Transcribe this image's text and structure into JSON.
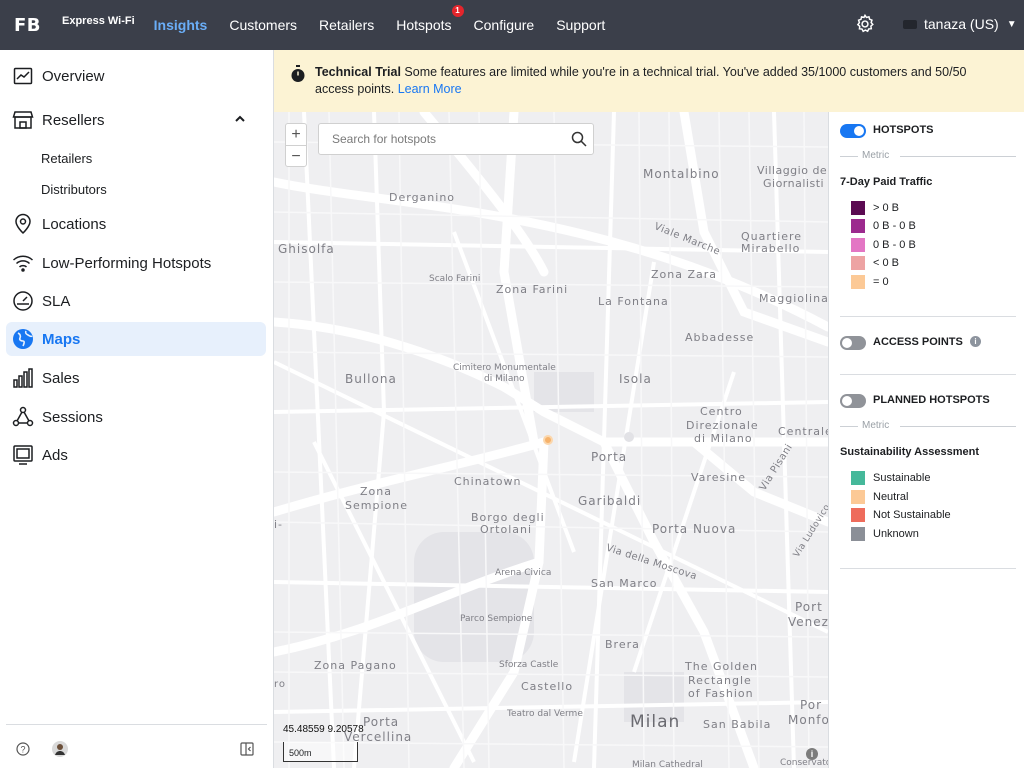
{
  "topbar": {
    "logo": "FB",
    "product": "Express Wi-Fi",
    "nav": [
      {
        "label": "Insights",
        "active": true
      },
      {
        "label": "Customers"
      },
      {
        "label": "Retailers"
      },
      {
        "label": "Hotspots",
        "badge": "1"
      },
      {
        "label": "Configure"
      },
      {
        "label": "Support"
      }
    ],
    "account": "tanaza (US)"
  },
  "sidebar": {
    "items": [
      {
        "label": "Overview",
        "icon": "line-chart-icon"
      },
      {
        "label": "Resellers",
        "icon": "store-icon",
        "expanded": true
      },
      {
        "label": "Locations",
        "icon": "location-pin-icon"
      },
      {
        "label": "Low-Performing Hotspots",
        "icon": "wifi-icon"
      },
      {
        "label": "SLA",
        "icon": "gauge-icon"
      },
      {
        "label": "Maps",
        "icon": "globe-icon",
        "active": true
      },
      {
        "label": "Sales",
        "icon": "bar-chart-icon"
      },
      {
        "label": "Sessions",
        "icon": "network-icon"
      },
      {
        "label": "Ads",
        "icon": "monitor-icon"
      }
    ],
    "subitems": [
      "Retailers",
      "Distributors"
    ]
  },
  "banner": {
    "title": "Technical Trial",
    "text": "Some features are limited while you're in a technical trial. You've added 35/1000 customers and 50/50 access points.",
    "link": "Learn More"
  },
  "map": {
    "search_placeholder": "Search for hotspots",
    "zoom_in": "+",
    "zoom_out": "−",
    "coordinates": "45.48559 9.20578",
    "scale": "500m",
    "info": "i",
    "labels": [
      {
        "text": "Montalbino"
      },
      {
        "text": "Villaggio dei"
      },
      {
        "text": "Giornalisti"
      },
      {
        "text": "Derganino"
      },
      {
        "text": "Ghisolfa"
      },
      {
        "text": "Viale Marche"
      },
      {
        "text": "Quartiere"
      },
      {
        "text": "Mirabello"
      },
      {
        "text": "Scalo Farini"
      },
      {
        "text": "Zona Zara"
      },
      {
        "text": "Zona Farini"
      },
      {
        "text": "La Fontana"
      },
      {
        "text": "Maggiolina"
      },
      {
        "text": "Abbadesse"
      },
      {
        "text": "Cimitero Monumentale"
      },
      {
        "text": "di Milano"
      },
      {
        "text": "Bullona"
      },
      {
        "text": "Isola"
      },
      {
        "text": "Centro"
      },
      {
        "text": "Direzionale"
      },
      {
        "text": "di Milano"
      },
      {
        "text": "Centrale"
      },
      {
        "text": "Chinatown"
      },
      {
        "text": "Varesine"
      },
      {
        "text": "Via Pisani"
      },
      {
        "text": "Porta"
      },
      {
        "text": "Garibaldi"
      },
      {
        "text": "Zona"
      },
      {
        "text": "Sempione"
      },
      {
        "text": "Borgo degli"
      },
      {
        "text": "Ortolani"
      },
      {
        "text": "Porta Nuova"
      },
      {
        "text": "Via Ludovico"
      },
      {
        "text": "Via della Moscova"
      },
      {
        "text": "Arena Civica"
      },
      {
        "text": "San Marco"
      },
      {
        "text": "Port"
      },
      {
        "text": "Venez"
      },
      {
        "text": "Parco Sempione"
      },
      {
        "text": "Brera"
      },
      {
        "text": "Zona Pagano"
      },
      {
        "text": "Sforza Castle"
      },
      {
        "text": "The Golden"
      },
      {
        "text": "Rectangle"
      },
      {
        "text": "of Fashion"
      },
      {
        "text": "Castello"
      },
      {
        "text": "ro"
      },
      {
        "text": "Teatro dal Verme"
      },
      {
        "text": "Porta"
      },
      {
        "text": "Vercellina"
      },
      {
        "text": "Milan"
      },
      {
        "text": "San Babila"
      },
      {
        "text": "Por"
      },
      {
        "text": "Monfo"
      },
      {
        "text": "Milan Cathedral"
      },
      {
        "text": "Conservato"
      },
      {
        "text": "i-"
      }
    ]
  },
  "panel": {
    "hotspots": {
      "label": "HOTSPOTS",
      "on": true
    },
    "metric_label": "Metric",
    "traffic_title": "7-Day Paid Traffic",
    "traffic_legend": [
      {
        "label": "> 0 B",
        "color": "#5b0a52"
      },
      {
        "label": "0 B - 0 B",
        "color": "#9c2a8e"
      },
      {
        "label": "0 B - 0 B",
        "color": "#e376c4"
      },
      {
        "label": "< 0 B",
        "color": "#eda3a3"
      },
      {
        "label": "= 0",
        "color": "#fcc996"
      }
    ],
    "access_points": {
      "label": "ACCESS POINTS",
      "on": false,
      "info": "i"
    },
    "planned": {
      "label": "PLANNED HOTSPOTS",
      "on": false
    },
    "metric_label2": "Metric",
    "sustain_title": "Sustainability Assessment",
    "sustain_legend": [
      {
        "label": "Sustainable",
        "color": "#45b89a"
      },
      {
        "label": "Neutral",
        "color": "#fcc996"
      },
      {
        "label": "Not Sustainable",
        "color": "#ee6c5c"
      },
      {
        "label": "Unknown",
        "color": "#8b8f97"
      }
    ]
  }
}
